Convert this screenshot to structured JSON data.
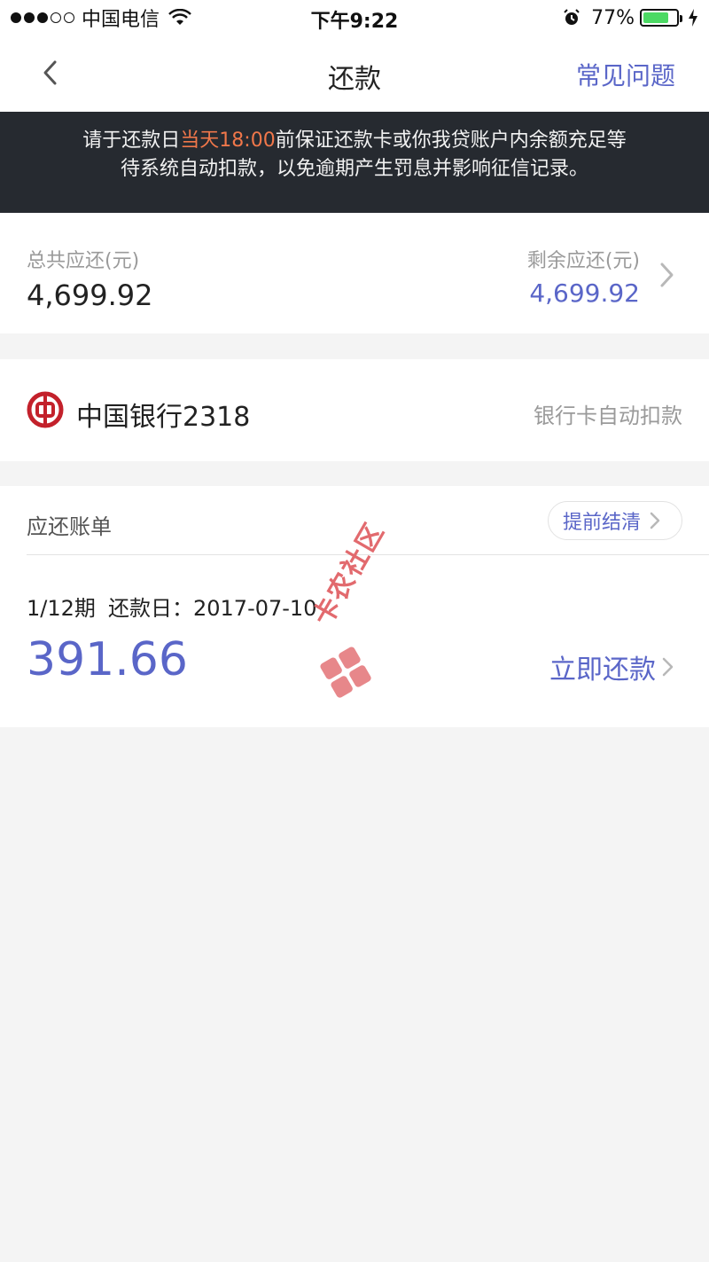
{
  "status_bar": {
    "carrier": "中国电信",
    "time": "下午9:22",
    "battery": "77%",
    "battery_level": 0.77
  },
  "nav": {
    "title": "还款",
    "faq": "常见问题"
  },
  "notice": {
    "line1_pre": "请于还款日",
    "line1_highlight": "当天18:00",
    "line1_post": "前保证还款卡或你我贷账户内余额充足等",
    "line2": "待系统自动扣款，以免逾期产生罚息并影响征信记录。"
  },
  "totals": {
    "total_label": "总共应还(元)",
    "total_value": "4,699.92",
    "remaining_label": "剩余应还(元)",
    "remaining_value": "4,699.92"
  },
  "bank": {
    "name": "中国银行2318",
    "method": "银行卡自动扣款"
  },
  "bills": {
    "title": "应还账单",
    "payoff_button": "提前结清",
    "items": [
      {
        "term": "1/12期",
        "due_label": "还款日：2017-07-10",
        "amount": "391.66",
        "action": "立即还款"
      }
    ]
  },
  "watermark": {
    "text": "卡农社区"
  },
  "colors": {
    "accent": "#5a66c8",
    "highlight": "#f0774a",
    "banner_bg": "#262a30",
    "page_bg": "#f4f4f4",
    "bank_red": "#c3212b",
    "battery_green": "#4cd964"
  }
}
